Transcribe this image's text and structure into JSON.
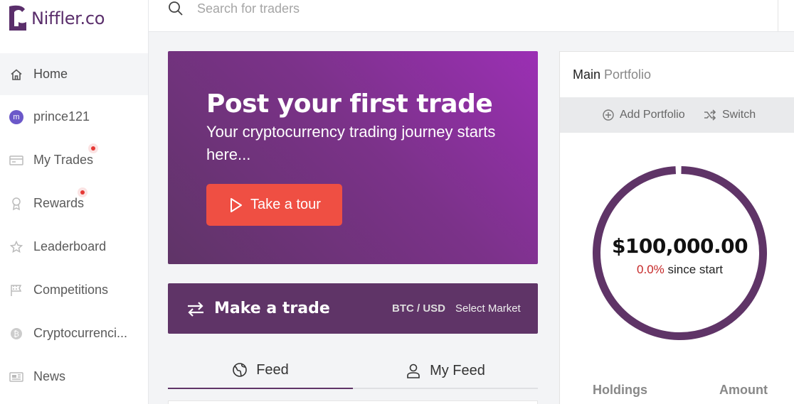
{
  "brand": {
    "name": "Niffler",
    "suffix": ".co",
    "color": "#5a2e6b"
  },
  "search": {
    "placeholder": "Search for traders"
  },
  "sidebar": {
    "items": [
      {
        "label": "Home",
        "icon": "home-icon",
        "active": true
      },
      {
        "label": "prince121",
        "icon": "avatar",
        "avatar_letter": "m"
      },
      {
        "label": "My Trades",
        "icon": "trades-icon",
        "notification": true
      },
      {
        "label": "Rewards",
        "icon": "award-icon",
        "notification": true
      },
      {
        "label": "Leaderboard",
        "icon": "star-icon"
      },
      {
        "label": "Competitions",
        "icon": "flag-icon"
      },
      {
        "label": "Cryptocurrenci...",
        "icon": "bitcoin-icon"
      },
      {
        "label": "News",
        "icon": "news-icon"
      }
    ]
  },
  "hero": {
    "title": "Post your first trade",
    "subtitle": "Your cryptocurrency trading journey starts here...",
    "button": "Take a tour"
  },
  "trade": {
    "title": "Make a trade",
    "pair": "BTC / USD",
    "select_market": "Select Market"
  },
  "feed_tabs": [
    {
      "label": "Feed",
      "icon": "globe-icon",
      "active": true
    },
    {
      "label": "My Feed",
      "icon": "user-icon",
      "active": false
    }
  ],
  "portfolio": {
    "title_main": "Main",
    "title_sub": "Portfolio",
    "add_label": "Add Portfolio",
    "switch_label": "Switch",
    "value": "$100,000.00",
    "change_pct": "0.0%",
    "change_text": "since start",
    "holdings_label": "Holdings",
    "amount_label": "Amount"
  },
  "colors": {
    "accent": "#5f3467",
    "hero_gradient_end": "#9b2fb4",
    "tour_button": "#ef4f43",
    "negative": "#c62828"
  }
}
